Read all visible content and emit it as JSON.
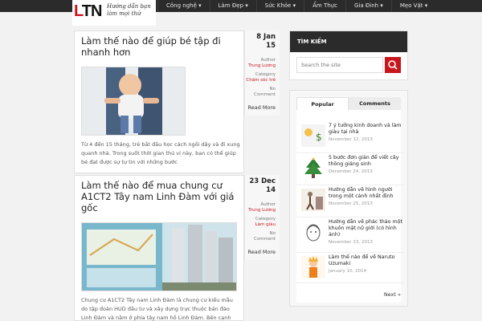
{
  "header": {
    "logo": "LTN",
    "tagline": "Hướng dẫn bạn làm mọi thứ",
    "nav": [
      "Công nghệ ▾",
      "Làm Đẹp ▾",
      "Sức Khỏe ▾",
      "Ẩm Thực",
      "Gia Đình ▾",
      "Mẹo Vặt ▾"
    ]
  },
  "posts": [
    {
      "title": "Làm thế nào để giúp bé tập đi nhanh hơn",
      "excerpt": "Từ 4 đến 15 tháng, trẻ bắt đầu học cách ngồi dậy và đi xung quanh nhà. Trong suốt thời gian thú vị này, bạn có thể giúp bé đạt được sự tự tin với những bước",
      "date_day": "8 Jan",
      "date_year": "15",
      "author_label": "Author",
      "author": "Trung Lương",
      "category_label": "Category",
      "category": "Chăm sóc trẻ",
      "comments_label": "No",
      "comments": "Comment",
      "read_more": "Read More"
    },
    {
      "title": "Làm thế nào để mua chung cư A1CT2 Tây nam Linh Đàm với giá gốc",
      "excerpt": "Chung cư A1CT2 Tây nam Linh Đàm là chung cư kiểu mẫu do tập đoàn HUD đầu tư và xây dựng trực thuộc bán đảo Linh Đàm và nằm ở phía tây nam hồ Linh Đàm. Bên cạnh",
      "date_day": "23 Dec",
      "date_year": "14",
      "author_label": "Author",
      "author": "Trung Lương",
      "category_label": "Category",
      "category": "Làm giàu",
      "comments_label": "No",
      "comments": "Comment",
      "read_more": "Read More"
    }
  ],
  "sidebar": {
    "search_title": "TÌM KIẾM",
    "search_placeholder": "Search the site",
    "tabs": [
      "Popular",
      "Comments"
    ],
    "popular": [
      {
        "title": "7 ý tưởng kinh doanh và làm giàu tại nhà",
        "date": "November 12, 2013"
      },
      {
        "title": "5 bước đơn giản để viết cây thông giáng sinh",
        "date": "December 24, 2013"
      },
      {
        "title": "Hướng dẫn vẽ hình người trong một cảnh nhất định",
        "date": "November 25, 2013"
      },
      {
        "title": "Hướng dẫn vẽ phác thảo một khuôn mặt nữ giới (có hình ảnh)",
        "date": "November 23, 2013"
      },
      {
        "title": "Làm thế nào để vẽ Naruto Uzumaki",
        "date": "January 10, 2014"
      }
    ],
    "next": "Next »"
  },
  "colors": {
    "accent": "#c8161d",
    "nav_bg": "#2b2b2b"
  }
}
